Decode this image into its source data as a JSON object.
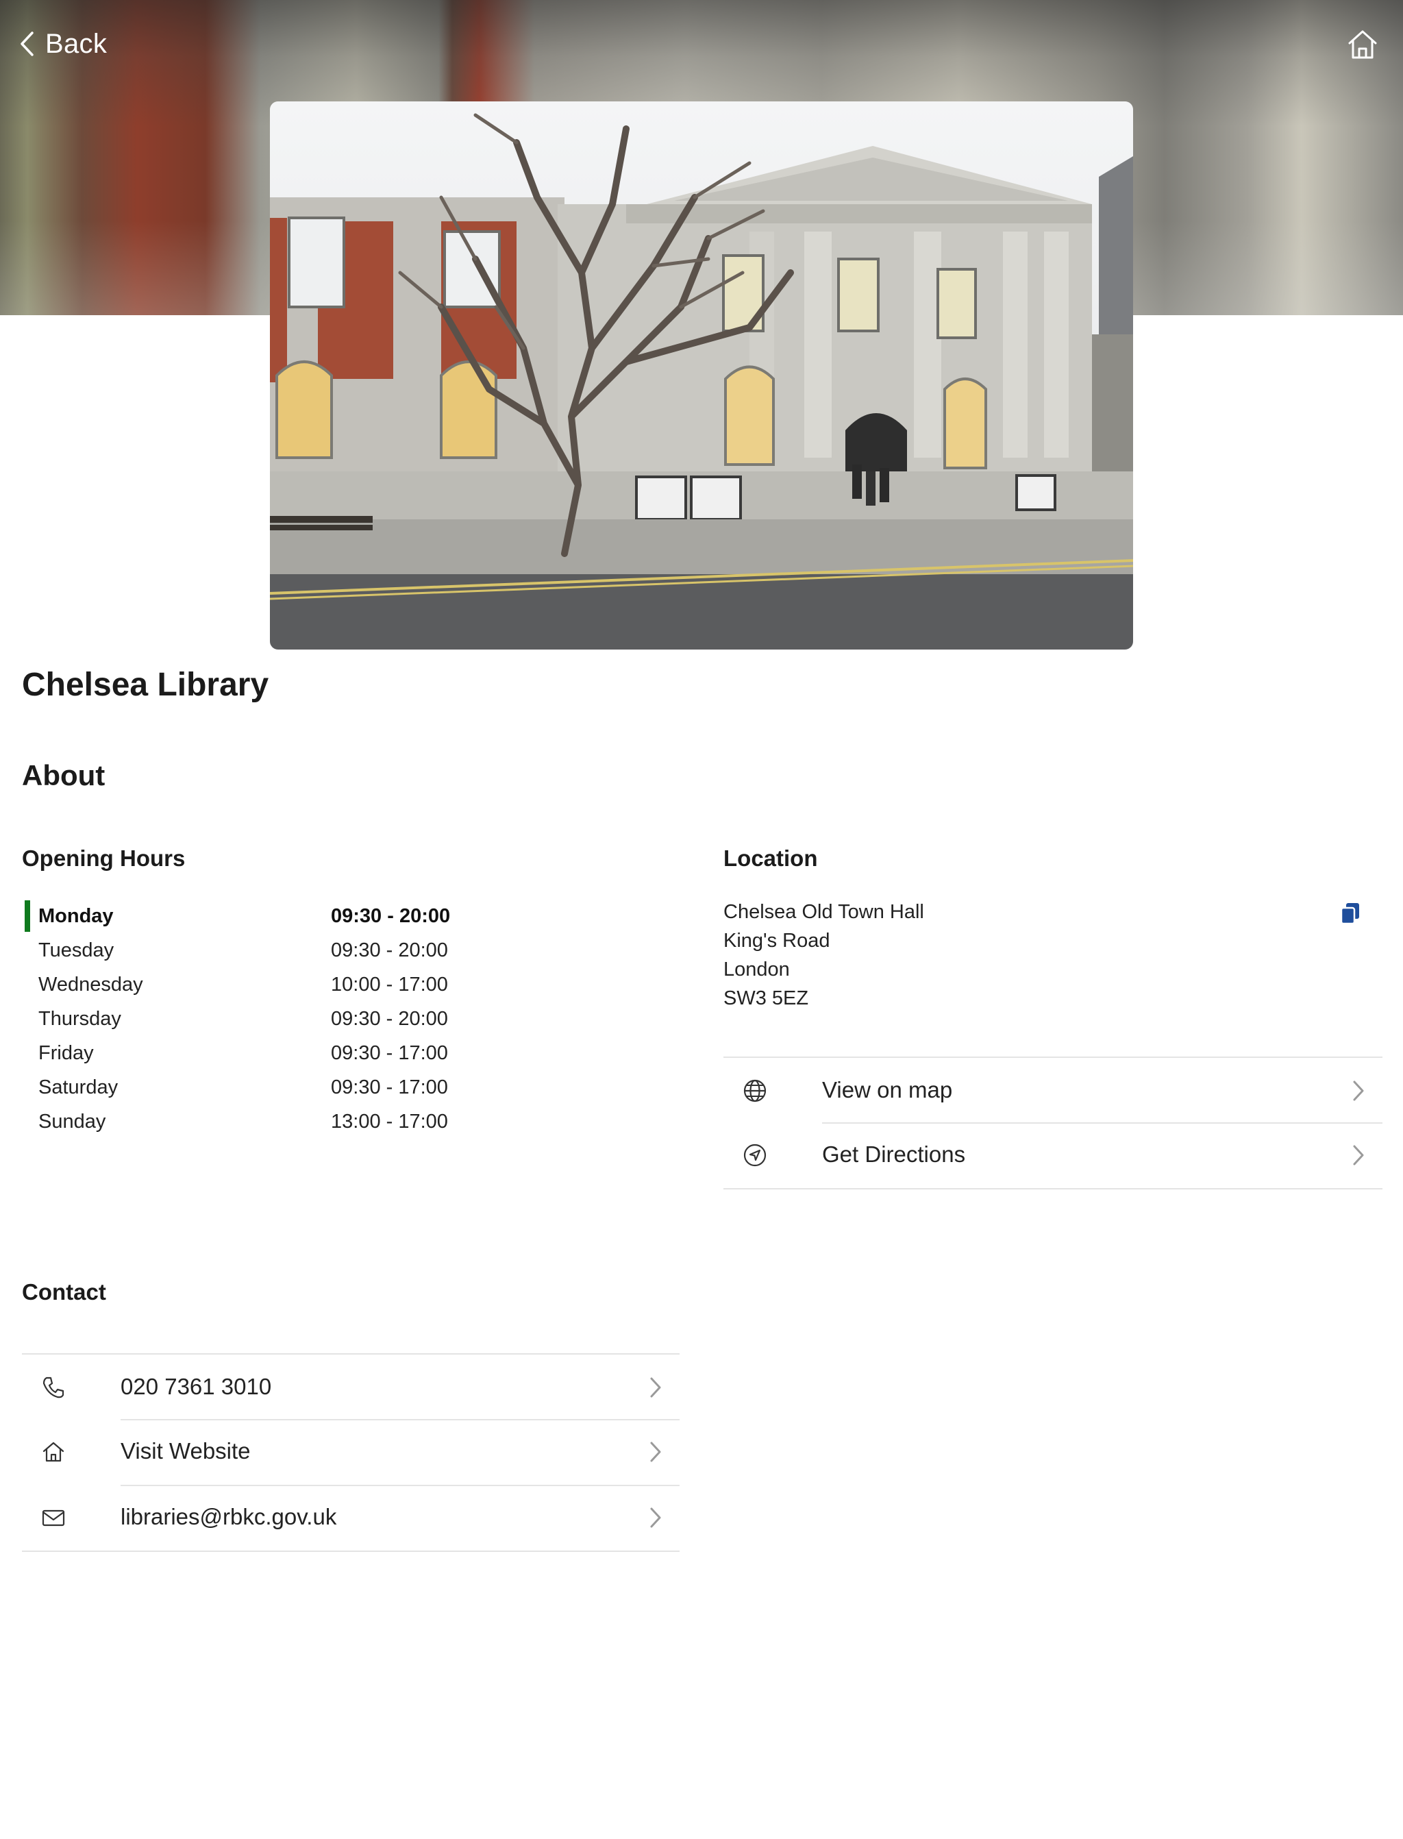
{
  "nav": {
    "back_label": "Back"
  },
  "library": {
    "name": "Chelsea Library"
  },
  "sections": {
    "about": "About",
    "opening_hours": "Opening Hours",
    "location": "Location",
    "contact": "Contact"
  },
  "hours": [
    {
      "day": "Monday",
      "time": "09:30 - 20:00",
      "today": true
    },
    {
      "day": "Tuesday",
      "time": "09:30 - 20:00"
    },
    {
      "day": "Wednesday",
      "time": "10:00 - 17:00"
    },
    {
      "day": "Thursday",
      "time": "09:30 - 20:00"
    },
    {
      "day": "Friday",
      "time": "09:30 - 17:00"
    },
    {
      "day": "Saturday",
      "time": "09:30 - 17:00"
    },
    {
      "day": "Sunday",
      "time": "13:00 - 17:00"
    }
  ],
  "address": {
    "line1": "Chelsea Old Town Hall",
    "line2": "King's Road",
    "line3": "London",
    "line4": "SW3 5EZ"
  },
  "location_actions": {
    "view_map": "View on map",
    "directions": "Get Directions"
  },
  "contact": {
    "phone": "020 7361 3010",
    "website": "Visit Website",
    "email": "libraries@rbkc.gov.uk"
  },
  "colors": {
    "today_accent": "#0f7a1e",
    "copy_icon": "#1f4e9c",
    "divider": "#e4e4e4"
  },
  "icons": {
    "back": "chevron-left-icon",
    "home": "home-icon",
    "copy": "copy-icon",
    "map": "globe-icon",
    "directions": "navigation-arrow-icon",
    "phone": "phone-icon",
    "website": "house-icon",
    "email": "envelope-icon"
  }
}
